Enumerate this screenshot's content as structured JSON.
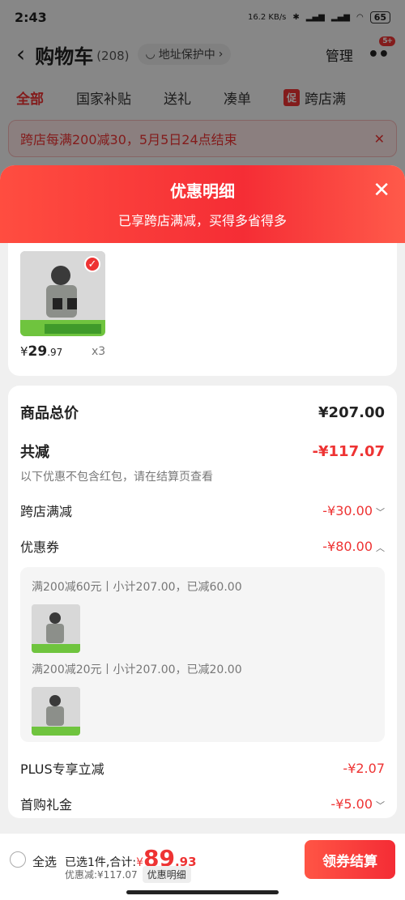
{
  "status": {
    "time": "2:43",
    "net_speed": "16.2 KB/s",
    "battery": "65"
  },
  "nav": {
    "title": "购物车",
    "count": "(208)",
    "addr": "地址保护中",
    "manage": "管理",
    "badge": "5+"
  },
  "tabs": [
    {
      "label": "全部"
    },
    {
      "label": "国家补贴"
    },
    {
      "label": "送礼"
    },
    {
      "label": "凑单"
    },
    {
      "label": "跨店满",
      "tag": "促"
    }
  ],
  "notice": {
    "text": "跨店每满200减30，5月5日24点结束"
  },
  "sheet": {
    "title": "优惠明细",
    "subtitle": "已享跨店满减，买得多省得多"
  },
  "product": {
    "price_symbol": "¥",
    "price_int": "29",
    "price_dec": ".97",
    "qty": "x3"
  },
  "summary": {
    "total_label": "商品总价",
    "total_value": "¥207.00",
    "reduce_label": "共减",
    "reduce_value": "-¥117.07",
    "note": "以下优惠不包含红包，请在结算页查看",
    "cross_label": "跨店满减",
    "cross_value": "-¥30.00",
    "coupon_label": "优惠券",
    "coupon_value": "-¥80.00",
    "coupons": [
      {
        "text": "满200减60元丨小计207.00，已减60.00"
      },
      {
        "text": "满200减20元丨小计207.00，已减20.00"
      }
    ],
    "plus_label": "PLUS专享立减",
    "plus_value": "-¥2.07",
    "first_label": "首购礼金",
    "first_value": "-¥5.00"
  },
  "bottom": {
    "select_all": "全选",
    "selected_text": "已选1件,合计:",
    "sym": "¥",
    "total_int": "89",
    "total_dec": ".93",
    "saved": "优惠减:¥117.07",
    "detail_btn": "优惠明细",
    "checkout": "领券结算"
  },
  "colors": {
    "accent": "#e33333"
  }
}
